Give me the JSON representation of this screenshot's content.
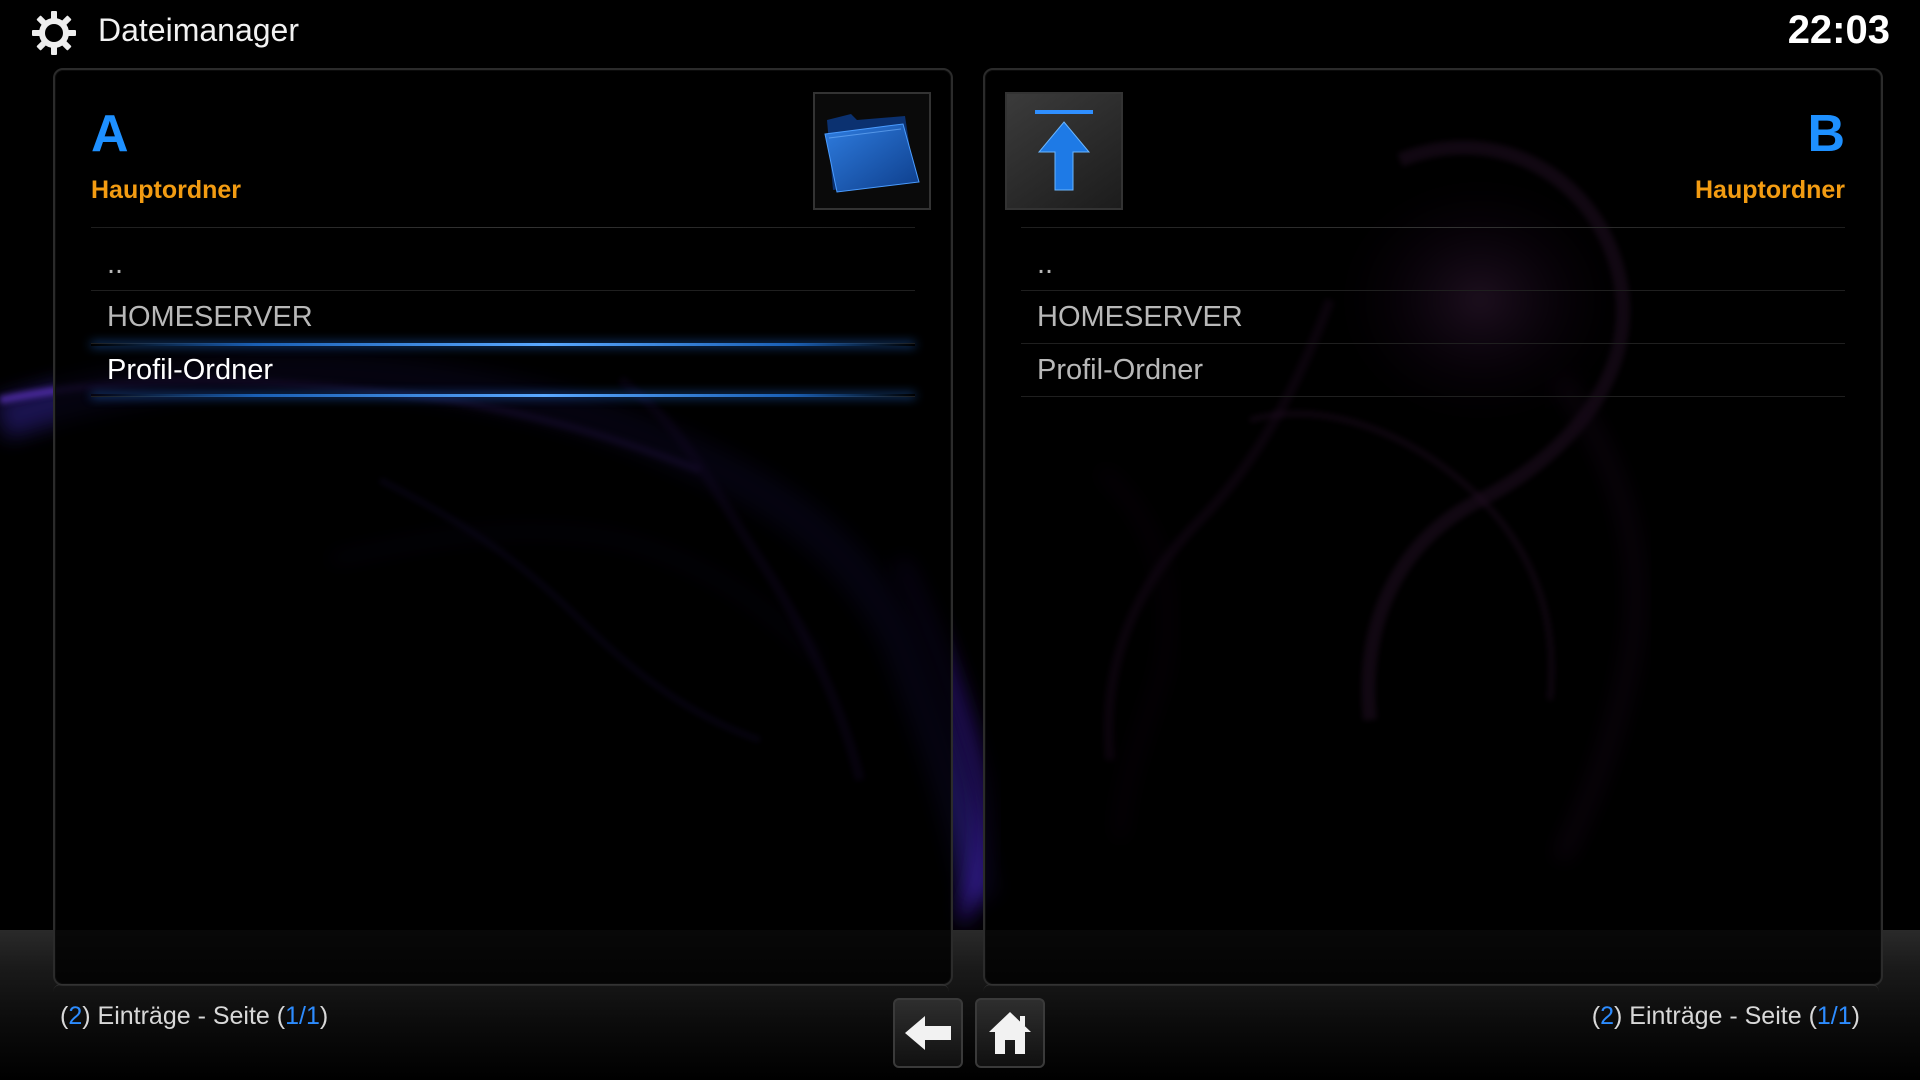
{
  "header": {
    "title": "Dateimanager",
    "clock": "22:03"
  },
  "panels": [
    {
      "letter": "A",
      "location": "Hauptordner",
      "thumbnail_icon": "blue-folder-icon",
      "items": [
        {
          "label": ".."
        },
        {
          "label": "HOMESERVER"
        },
        {
          "label": "Profil-Ordner",
          "focused": true
        }
      ],
      "status": {
        "count": "2",
        "text_entries": "Einträge - Seite",
        "page": "1/1"
      }
    },
    {
      "letter": "B",
      "location": "Hauptordner",
      "thumbnail_icon": "parent-folder-up-arrow-icon",
      "items": [
        {
          "label": ".."
        },
        {
          "label": "HOMESERVER"
        },
        {
          "label": "Profil-Ordner"
        }
      ],
      "status": {
        "count": "2",
        "text_entries": "Einträge - Seite",
        "page": "1/1"
      }
    }
  ],
  "nav": {
    "back_icon": "back-arrow-icon",
    "home_icon": "home-icon"
  },
  "colors": {
    "accent_blue": "#1e90ff",
    "location_orange": "#f39c12",
    "focus_glow": "#5aa8ff"
  }
}
